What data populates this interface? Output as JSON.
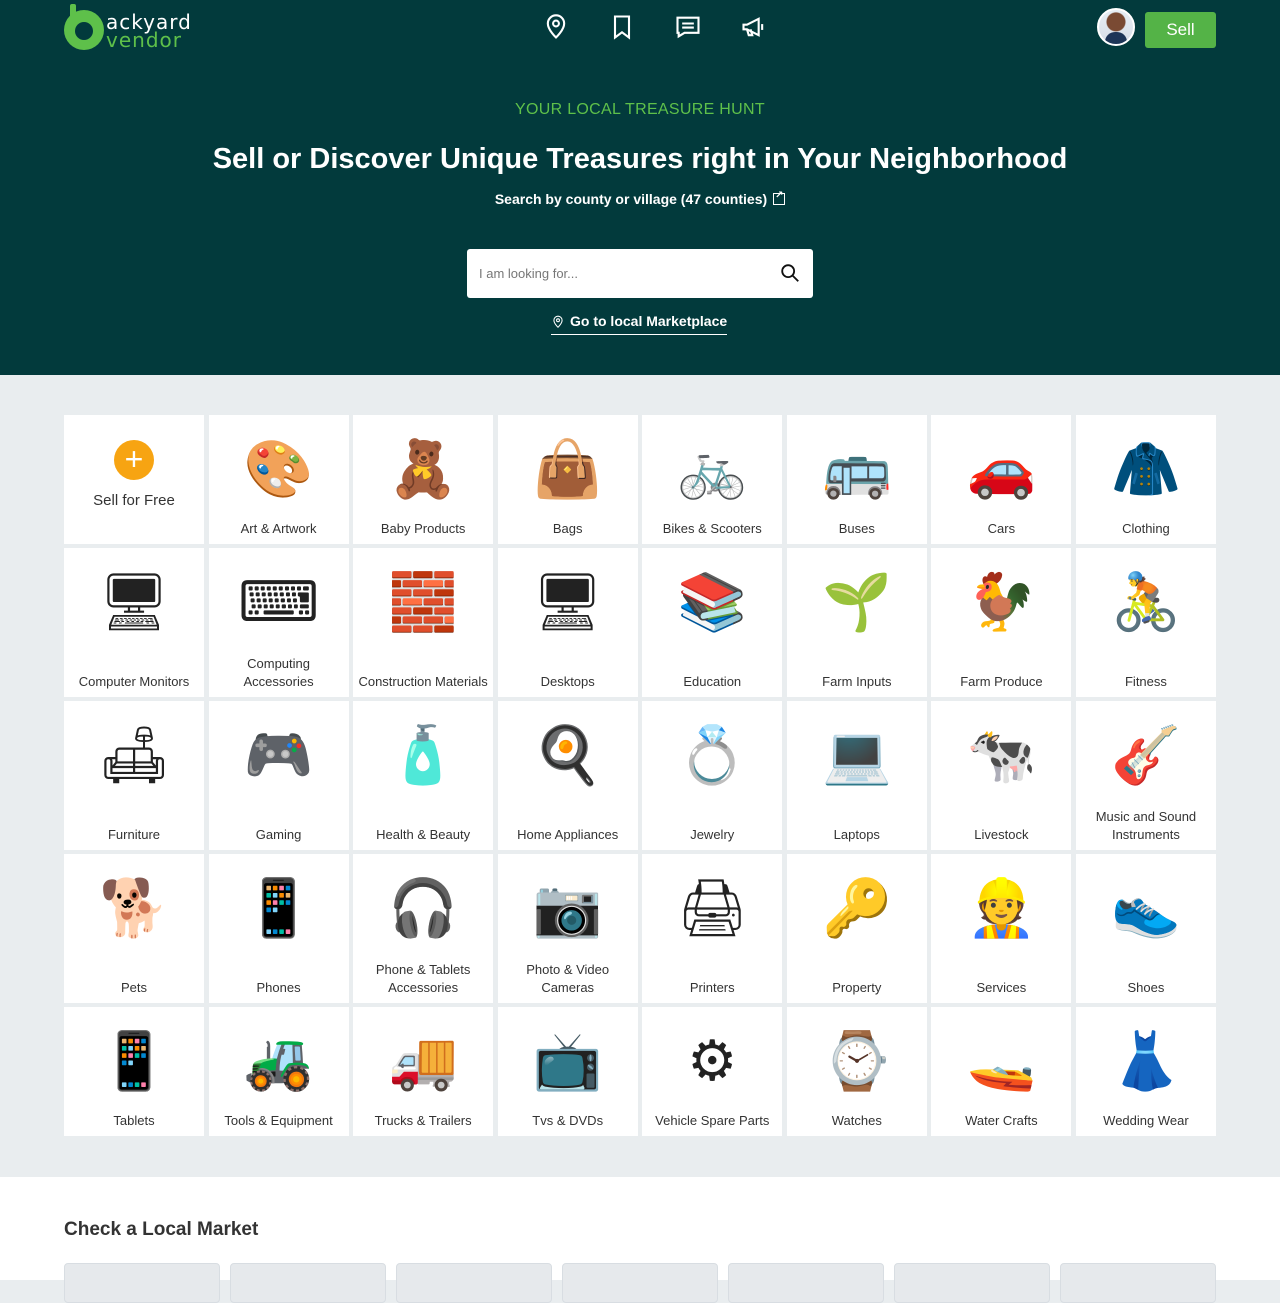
{
  "brand": {
    "line1": "ackyard",
    "line2": "vendor"
  },
  "header": {
    "nav_icons": [
      "location-pin-icon",
      "bookmark-icon",
      "messages-icon",
      "megaphone-icon"
    ],
    "sell_label": "Sell"
  },
  "hero": {
    "kicker": "YOUR LOCAL TREASURE HUNT",
    "title": "Sell or Discover Unique Treasures right in Your Neighborhood",
    "subtitle": "Search by county or village (47 counties)",
    "search_placeholder": "I am looking for...",
    "local_link": "Go to local Marketplace"
  },
  "colors": {
    "header_bg": "#023a3c",
    "accent_green": "#54b347",
    "plus_orange": "#f7a412",
    "page_bg": "#e9edef"
  },
  "categories": {
    "sell_free": "Sell for Free",
    "items": [
      "Art & Artwork",
      "Baby Products",
      "Bags",
      "Bikes & Scooters",
      "Buses",
      "Cars",
      "Clothing",
      "Computer Monitors",
      "Computing Accessories",
      "Construction Materials",
      "Desktops",
      "Education",
      "Farm Inputs",
      "Farm Produce",
      "Fitness",
      "Furniture",
      "Gaming",
      "Health & Beauty",
      "Home Appliances",
      "Jewelry",
      "Laptops",
      "Livestock",
      "Music and Sound Instruments",
      "Pets",
      "Phones",
      "Phone & Tablets Accessories",
      "Photo & Video Cameras",
      "Printers",
      "Property",
      "Services",
      "Shoes",
      "Tablets",
      "Tools & Equipment",
      "Trucks & Trailers",
      "Tvs & DVDs",
      "Vehicle Spare Parts",
      "Watches",
      "Water Crafts",
      "Wedding Wear"
    ]
  },
  "market": {
    "title": "Check a Local Market"
  }
}
